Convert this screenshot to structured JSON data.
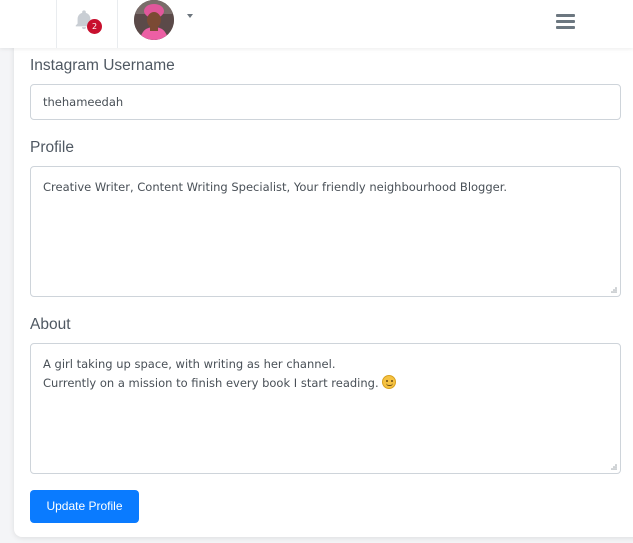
{
  "header": {
    "notifications": {
      "icon": "bell-icon",
      "count": "2",
      "badge_color": "#c8102e"
    },
    "user_menu": {
      "avatar": "user-avatar",
      "dropdown_icon": "caret-down-icon"
    },
    "menu_icon": "hamburger-menu-icon"
  },
  "form": {
    "instagram": {
      "label": "Instagram Username",
      "value": "thehameedah"
    },
    "profile": {
      "label": "Profile",
      "value": "Creative Writer, Content Writing Specialist, Your friendly neighbourhood Blogger."
    },
    "about": {
      "label": "About",
      "lines": [
        "A girl taking up space, with writing as her channel.",
        "Currently on a mission to finish every book I start reading."
      ],
      "emoji": "slightly-smiling-face-emoji"
    },
    "submit_label": "Update Profile"
  },
  "colors": {
    "primary": "#0a7bff",
    "page_bg": "#f4f5f7",
    "field_border": "#ced4da"
  }
}
